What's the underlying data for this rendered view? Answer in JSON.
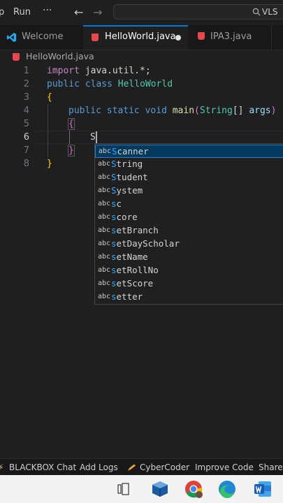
{
  "titlebar": {
    "menu_partial": "p",
    "menu_run": "Run",
    "more": "···",
    "back_arrow": "←",
    "forward_arrow": "→",
    "search_text": "VLS"
  },
  "tabs": [
    {
      "label": "Welcome",
      "icon": "vscode-icon",
      "active": false
    },
    {
      "label": "HelloWorld.java",
      "icon": "java-file-icon",
      "active": true,
      "unsaved": true
    },
    {
      "label": "IPA3.java",
      "icon": "java-file-icon",
      "active": false
    }
  ],
  "breadcrumb": {
    "file": "HelloWorld.java"
  },
  "editor": {
    "line_numbers": [
      "1",
      "2",
      "3",
      "4",
      "5",
      "6",
      "7",
      "8"
    ],
    "current_line": "6",
    "lines": {
      "l1": {
        "kw": "import",
        "rest": " java.util.*;"
      },
      "l2": {
        "kw1": "public",
        "kw2": "class",
        "name": "HelloWorld"
      },
      "l3": {
        "brace": "{"
      },
      "l4": {
        "kw1": "public",
        "kw2": "static",
        "kw3": "void",
        "fn": "main",
        "p1": "(",
        "type": "String",
        "arr": "[] ",
        "arg": "args",
        "p2": ")"
      },
      "l5": {
        "brace": "{"
      },
      "l6": {
        "typed": "S"
      },
      "l7": {
        "brace": "}"
      },
      "l8": {
        "brace": "}"
      }
    }
  },
  "suggestions": {
    "kind_label": "abc",
    "items": [
      {
        "match": "S",
        "rest": "canner"
      },
      {
        "match": "S",
        "rest": "tring"
      },
      {
        "match": "S",
        "rest": "tudent"
      },
      {
        "match": "S",
        "rest": "ystem"
      },
      {
        "match": "s",
        "rest": "c"
      },
      {
        "match": "s",
        "rest": "core"
      },
      {
        "match": "s",
        "rest": "etBranch"
      },
      {
        "match": "s",
        "rest": "etDayScholar"
      },
      {
        "match": "s",
        "rest": "etName"
      },
      {
        "match": "s",
        "rest": "etRollNo"
      },
      {
        "match": "s",
        "rest": "etScore"
      },
      {
        "match": "s",
        "rest": "etter"
      }
    ],
    "selected_index": 0
  },
  "statusbar": {
    "items": [
      "BLACKBOX Chat",
      "Add Logs",
      "CyberCoder",
      "Improve Code",
      "Share C"
    ]
  },
  "taskbar": {
    "icons": [
      "task-view-icon",
      "virtualbox-icon",
      "chrome-icon",
      "edge-icon",
      "word-icon"
    ]
  },
  "colors": {
    "accent": "#0078d4",
    "background": "#1f1f1f",
    "keyword": "#569cd6",
    "match_highlight": "#2aaaff"
  }
}
